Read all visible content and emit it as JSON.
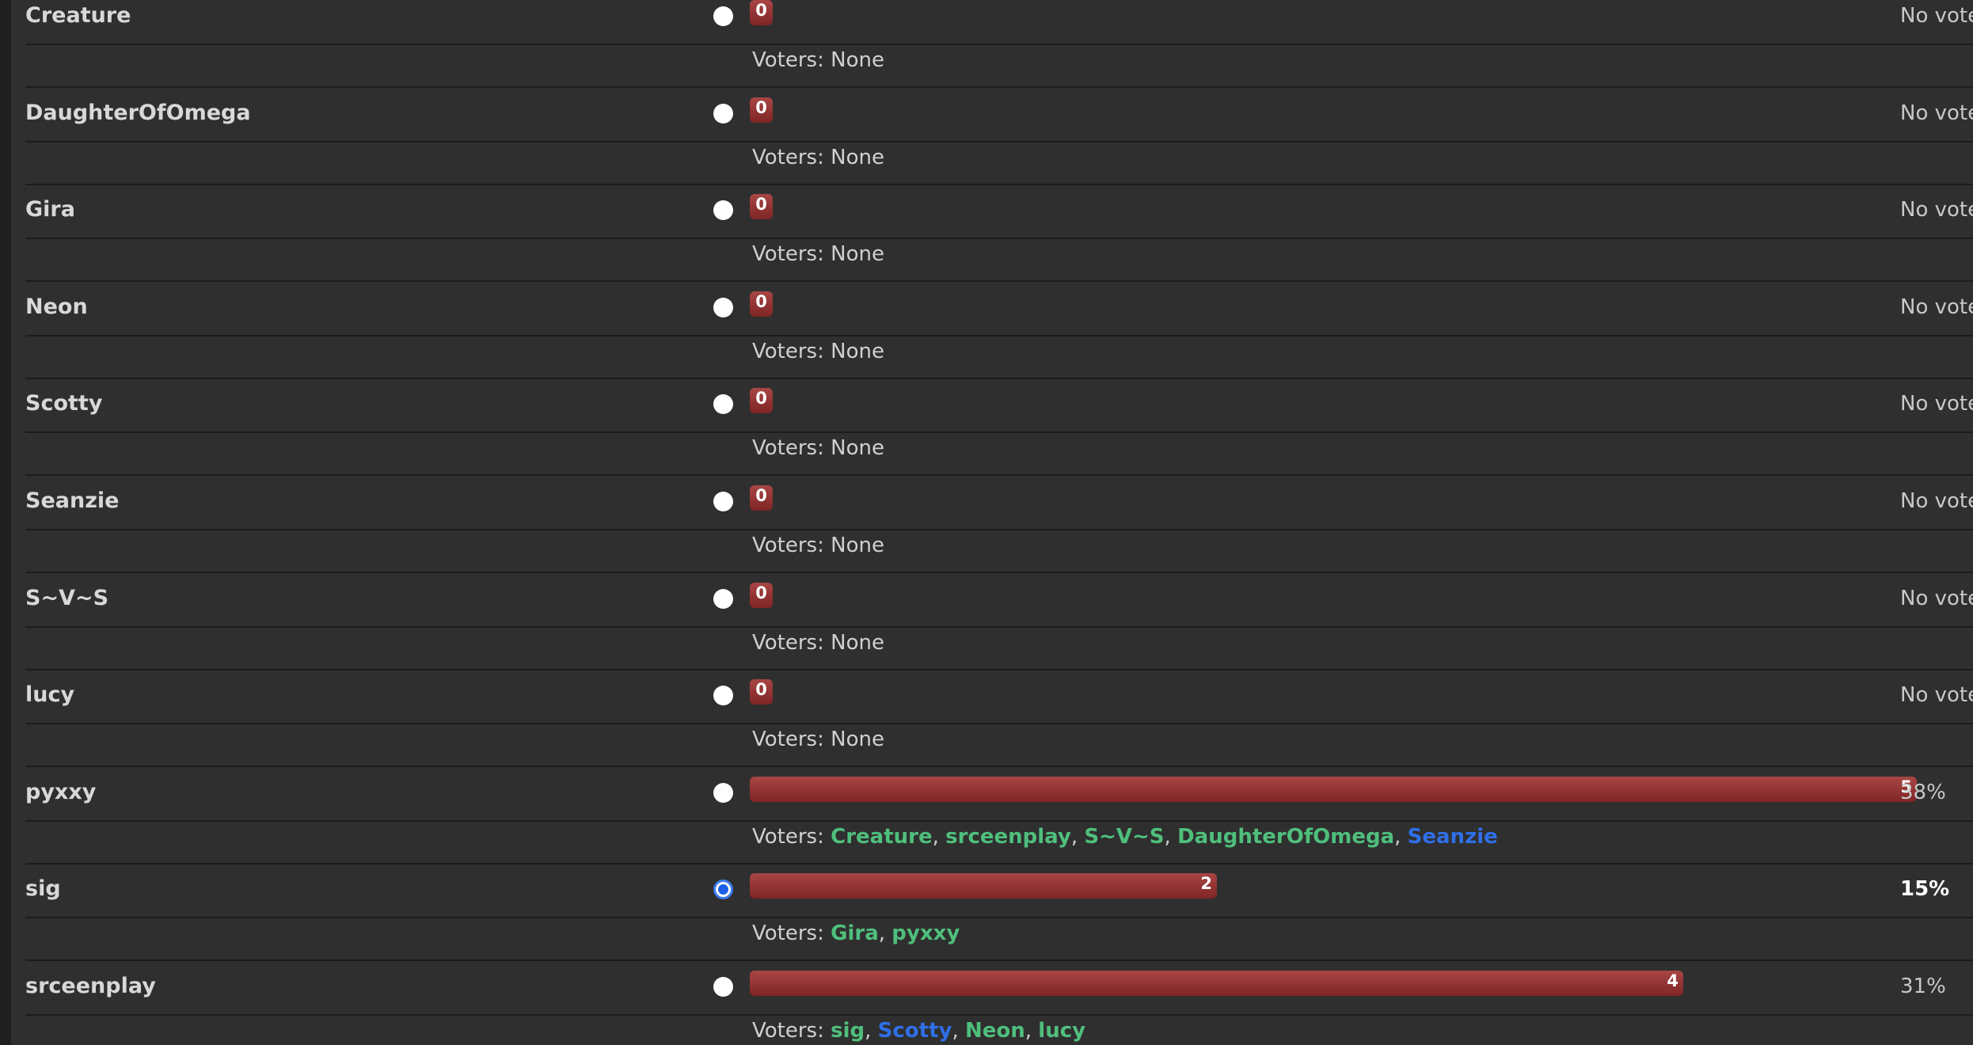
{
  "poll": {
    "voters_prefix": "Voters: ",
    "options": [
      {
        "name": "Creature",
        "count": "0",
        "share": 0,
        "result": "No vote",
        "checked": false,
        "voters_none": "None",
        "voters": []
      },
      {
        "name": "DaughterOfOmega",
        "count": "0",
        "share": 0,
        "result": "No vote",
        "checked": false,
        "voters_none": "None",
        "voters": []
      },
      {
        "name": "Gira",
        "count": "0",
        "share": 0,
        "result": "No vote",
        "checked": false,
        "voters_none": "None",
        "voters": []
      },
      {
        "name": "Neon",
        "count": "0",
        "share": 0,
        "result": "No vote",
        "checked": false,
        "voters_none": "None",
        "voters": []
      },
      {
        "name": "Scotty",
        "count": "0",
        "share": 0,
        "result": "No vote",
        "checked": false,
        "voters_none": "None",
        "voters": []
      },
      {
        "name": "Seanzie",
        "count": "0",
        "share": 0,
        "result": "No vote",
        "checked": false,
        "voters_none": "None",
        "voters": []
      },
      {
        "name": "S~V~S",
        "count": "0",
        "share": 0,
        "result": "No vote",
        "checked": false,
        "voters_none": "None",
        "voters": []
      },
      {
        "name": "lucy",
        "count": "0",
        "share": 0,
        "result": "No vote",
        "checked": false,
        "voters_none": "None",
        "voters": []
      },
      {
        "name": "pyxxy",
        "count": "5",
        "share": 1.0,
        "result": "38%",
        "checked": false,
        "voters_none": "",
        "voters": [
          {
            "name": "Creature",
            "color": "#4fbf7c"
          },
          {
            "name": "srceenplay",
            "color": "#4fbf7c"
          },
          {
            "name": "S~V~S",
            "color": "#4fbf7c"
          },
          {
            "name": "DaughterOfOmega",
            "color": "#4fbf7c"
          },
          {
            "name": "Seanzie",
            "color": "#2f6fe8"
          }
        ]
      },
      {
        "name": "sig",
        "count": "2",
        "share": 0.4,
        "result": "15%",
        "checked": true,
        "voters_none": "",
        "voters": [
          {
            "name": "Gira",
            "color": "#4fbf7c"
          },
          {
            "name": "pyxxy",
            "color": "#4fbf7c"
          }
        ]
      },
      {
        "name": "srceenplay",
        "count": "4",
        "share": 0.8,
        "result": "31%",
        "checked": false,
        "voters_none": "",
        "voters": [
          {
            "name": "sig",
            "color": "#4fbf7c"
          },
          {
            "name": "Scotty",
            "color": "#2f6fe8"
          },
          {
            "name": "Neon",
            "color": "#4fbf7c"
          },
          {
            "name": "lucy",
            "color": "#4fbf7c"
          }
        ]
      }
    ]
  },
  "colors": {
    "background": "#2f2f2f",
    "bar": "#8f3030",
    "voter_green": "#4fbf7c",
    "voter_blue": "#2f6fe8",
    "text": "#d8d8d8"
  }
}
